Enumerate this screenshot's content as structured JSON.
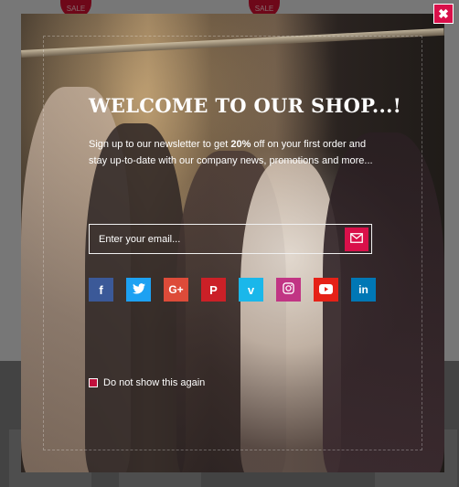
{
  "background": {
    "sale_badges": [
      "SALE",
      "SALE"
    ]
  },
  "popup": {
    "title": "WELCOME TO OUR SHOP...!",
    "description_prefix": "Sign up to our newsletter to get ",
    "description_highlight": "20%",
    "description_suffix": " off on your first order  and stay up-to-date  with our company news, promotions and more...",
    "email_placeholder": "Enter your email...",
    "submit_icon": "envelope-icon",
    "social_links": [
      {
        "name": "facebook",
        "glyph": "f",
        "color": "#3b5998"
      },
      {
        "name": "twitter",
        "glyph": "t",
        "color": "#1da1f2"
      },
      {
        "name": "google-plus",
        "glyph": "G+",
        "color": "#dd4b39"
      },
      {
        "name": "pinterest",
        "glyph": "P",
        "color": "#cb2027"
      },
      {
        "name": "vimeo",
        "glyph": "v",
        "color": "#1ab7ea"
      },
      {
        "name": "instagram",
        "glyph": "◎",
        "color": "#c13584"
      },
      {
        "name": "youtube",
        "glyph": "▶",
        "color": "#e62117"
      },
      {
        "name": "linkedin",
        "glyph": "in",
        "color": "#0077b5"
      }
    ],
    "dont_show_label": "Do not show this again",
    "close_icon": "close-icon"
  }
}
